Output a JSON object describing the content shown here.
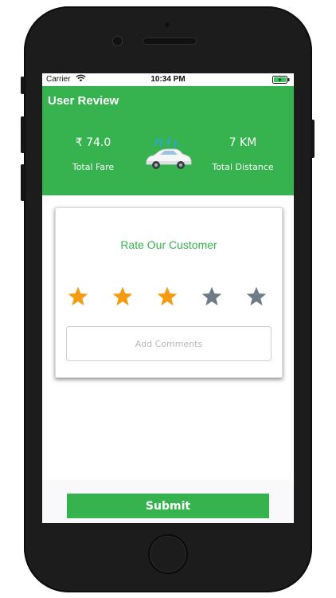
{
  "status_bar": {
    "carrier": "Carrier",
    "time": "10:34 PM"
  },
  "header": {
    "title": "User Review",
    "fare_value": "₹ 74.0",
    "fare_label": "Total Fare",
    "distance_value": "7 KM",
    "distance_label": "Total Distance"
  },
  "card": {
    "title": "Rate Our Customer",
    "rating": 3,
    "max_rating": 5,
    "comment_placeholder": "Add Comments",
    "comment_value": ""
  },
  "submit_label": "Submit",
  "colors": {
    "brand_green": "#36b24f",
    "star_filled": "#f39c12",
    "star_empty": "#6f7b86",
    "card_title": "#36b24f"
  },
  "icons": {
    "car": "car-icon",
    "wifi": "wifi-icon",
    "battery": "battery-charging-icon",
    "star": "star-icon"
  }
}
